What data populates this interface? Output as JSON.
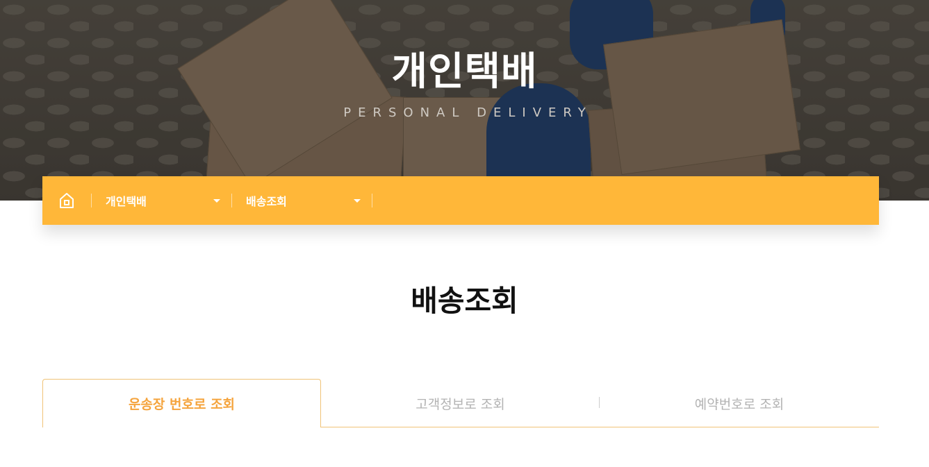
{
  "hero": {
    "title": "개인택배",
    "subtitle": "PERSONAL DELIVERY"
  },
  "navbar": {
    "home_icon": "home-icon",
    "dropdown1": {
      "label": "개인택배",
      "icon": "caret-down-icon"
    },
    "dropdown2": {
      "label": "배송조회",
      "icon": "caret-down-icon"
    },
    "accent_color": "#ffb739"
  },
  "page": {
    "title": "배송조회"
  },
  "tabs": {
    "items": [
      {
        "label": "운송장 번호로 조회",
        "active": true
      },
      {
        "label": "고객정보로 조회",
        "active": false
      },
      {
        "label": "예약번호로 조회",
        "active": false
      }
    ],
    "active_color": "#f5a43d",
    "inactive_color": "#b3b3b3"
  }
}
